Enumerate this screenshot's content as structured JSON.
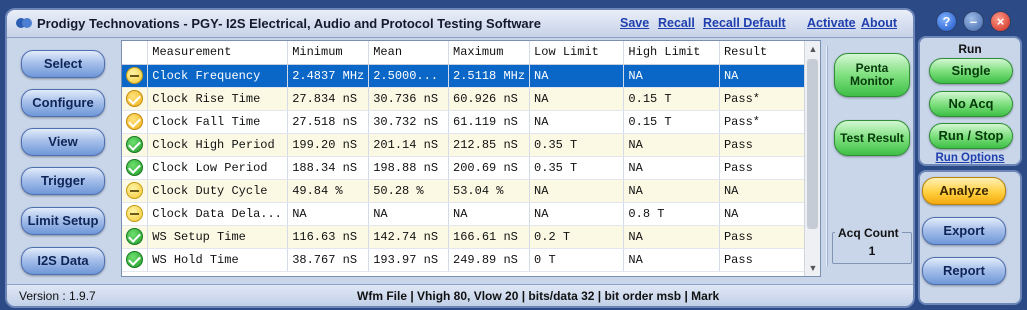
{
  "app": {
    "title": "Prodigy Technovations - PGY- I2S Electrical, Audio and Protocol Testing Software",
    "links": [
      "Save",
      "Recall",
      "Recall Default",
      "Activate",
      "About"
    ]
  },
  "nav": [
    "Select",
    "Configure",
    "View",
    "Trigger",
    "Limit Setup",
    "I2S Data"
  ],
  "table": {
    "columns": [
      "Measurement",
      "Minimum",
      "Mean",
      "Maximum",
      "Low Limit",
      "High Limit",
      "Result"
    ],
    "rows": [
      {
        "status": "neutral",
        "cells": [
          "Clock Frequency",
          "2.4837 MHz",
          "2.5000...",
          "2.5118 MHz",
          "NA",
          "NA",
          "NA"
        ]
      },
      {
        "status": "warn",
        "cells": [
          "Clock Rise Time",
          "27.834 nS",
          "30.736 nS",
          "60.926 nS",
          "NA",
          "0.15 T",
          "Pass*"
        ]
      },
      {
        "status": "warn",
        "cells": [
          "Clock Fall Time",
          "27.518 nS",
          "30.732 nS",
          "61.119 nS",
          "NA",
          "0.15 T",
          "Pass*"
        ]
      },
      {
        "status": "pass",
        "cells": [
          "Clock High Period",
          "199.20 nS",
          "201.14 nS",
          "212.85 nS",
          "0.35 T",
          "NA",
          "Pass"
        ]
      },
      {
        "status": "pass",
        "cells": [
          "Clock Low Period",
          "188.34 nS",
          "198.88 nS",
          "200.69 nS",
          "0.35 T",
          "NA",
          "Pass"
        ]
      },
      {
        "status": "neutral",
        "cells": [
          "Clock Duty Cycle",
          "49.84 %",
          "50.28 %",
          "53.04 %",
          "NA",
          "NA",
          "NA"
        ]
      },
      {
        "status": "neutral",
        "cells": [
          "Clock Data Dela...",
          "NA",
          "NA",
          "NA",
          "NA",
          "0.8 T",
          "NA"
        ]
      },
      {
        "status": "pass",
        "cells": [
          "WS Setup Time",
          "116.63 nS",
          "142.74 nS",
          "166.61 nS",
          "0.2 T",
          "NA",
          "Pass"
        ]
      },
      {
        "status": "pass",
        "cells": [
          "WS Hold Time",
          "38.767 nS",
          "193.97 nS",
          "249.89 nS",
          "0 T",
          "NA",
          "Pass"
        ]
      }
    ]
  },
  "side": {
    "penta_monitor": "Penta Monitor",
    "test_result": "Test Result",
    "acq_count_label": "Acq Count",
    "acq_count_value": "1"
  },
  "statusbar": {
    "version": "Version :  1.9.7",
    "wfm": "Wfm File | Vhigh 80, Vlow 20 | bits/data 32 | bit order msb | Mark"
  },
  "run": {
    "title": "Run",
    "buttons": [
      "Single",
      "No Acq",
      "Run / Stop"
    ],
    "options": "Run Options"
  },
  "actions": [
    "Analyze",
    "Export",
    "Report"
  ]
}
